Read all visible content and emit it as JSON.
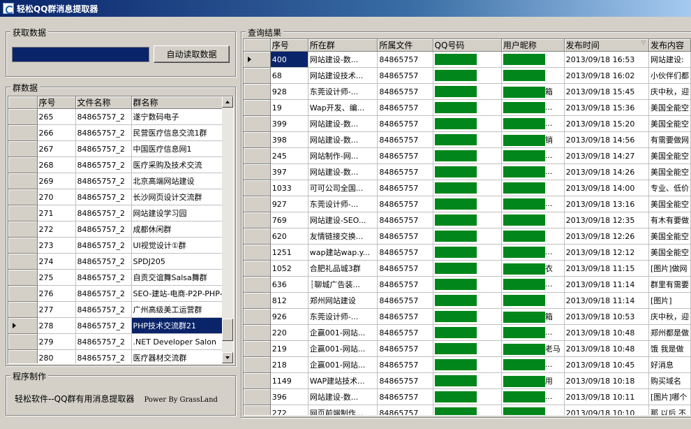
{
  "window": {
    "title": "轻松QQ群消息提取器"
  },
  "fetch_group": {
    "legend": "获取数据",
    "button_label": "自动读取数据"
  },
  "groups_panel": {
    "legend": "群数据",
    "columns": [
      "序号",
      "文件名称",
      "群名称"
    ],
    "rows": [
      {
        "id": "265",
        "file": "84865757_2",
        "name": "遂宁数码电子"
      },
      {
        "id": "266",
        "file": "84865757_2",
        "name": "民营医疗信息交流1群"
      },
      {
        "id": "267",
        "file": "84865757_2",
        "name": "中国医疗信息网1"
      },
      {
        "id": "268",
        "file": "84865757_2",
        "name": "医疗采购及技术交流"
      },
      {
        "id": "269",
        "file": "84865757_2",
        "name": "北京高端网站建设"
      },
      {
        "id": "270",
        "file": "84865757_2",
        "name": "长沙网页设计交流群"
      },
      {
        "id": "271",
        "file": "84865757_2",
        "name": "网站建设学习园"
      },
      {
        "id": "272",
        "file": "84865757_2",
        "name": "成都休闲群"
      },
      {
        "id": "273",
        "file": "84865757_2",
        "name": "UI视觉设计①群"
      },
      {
        "id": "274",
        "file": "84865757_2",
        "name": "SPDJ205"
      },
      {
        "id": "275",
        "file": "84865757_2",
        "name": "自贡交谊舞Salsa舞群"
      },
      {
        "id": "276",
        "file": "84865757_2",
        "name": "SEO-建站-电商-P2P-PHP-"
      },
      {
        "id": "277",
        "file": "84865757_2",
        "name": "广州高级美工运营群"
      },
      {
        "id": "278",
        "file": "84865757_2",
        "name": "PHP技术交流群21",
        "selected": true
      },
      {
        "id": "279",
        "file": "84865757_2",
        "name": ".NET Developer Salon"
      },
      {
        "id": "280",
        "file": "84865757_2",
        "name": "医疗器材交流群"
      }
    ]
  },
  "credits_group": {
    "legend": "程序制作",
    "text": "轻松软件--QQ群有用消息提取器",
    "power": "Power By GrassLand"
  },
  "results_panel": {
    "legend": "查询结果",
    "columns": [
      "序号",
      "所在群",
      "所属文件",
      "QQ号码",
      "用户昵称",
      "发布时间",
      "发布内容"
    ],
    "rows": [
      {
        "id": "400",
        "group": "网站建设-数...",
        "file": "84865757",
        "nick_suffix": "",
        "time": "2013/09/18 16:53",
        "content": "网站建设:",
        "selected": true
      },
      {
        "id": "68",
        "group": "网站建设技术...",
        "file": "84865757",
        "nick_suffix": "",
        "time": "2013/09/18 16:02",
        "content": "小伙伴们都"
      },
      {
        "id": "928",
        "group": "东莞设计师-...",
        "file": "84865757",
        "nick_suffix": "箱",
        "time": "2013/09/18 15:45",
        "content": "庆中秋，迎"
      },
      {
        "id": "19",
        "group": "Wap开发、编...",
        "file": "84865757",
        "nick_suffix": "...",
        "time": "2013/09/18 15:36",
        "content": "美国全能空"
      },
      {
        "id": "399",
        "group": "网站建设-数...",
        "file": "84865757",
        "nick_suffix": "...",
        "time": "2013/09/18 15:20",
        "content": "美国全能空"
      },
      {
        "id": "398",
        "group": "网站建设-数...",
        "file": "84865757",
        "nick_suffix": "销",
        "time": "2013/09/18 14:56",
        "content": "有需要做网"
      },
      {
        "id": "245",
        "group": "网站制作-网...",
        "file": "84865757",
        "nick_suffix": "...",
        "time": "2013/09/18 14:27",
        "content": "美国全能空"
      },
      {
        "id": "397",
        "group": "网站建设-数...",
        "file": "84865757",
        "nick_suffix": "...",
        "time": "2013/09/18 14:26",
        "content": "美国全能空"
      },
      {
        "id": "1033",
        "group": "可可公司全国...",
        "file": "84865757",
        "nick_suffix": "",
        "time": "2013/09/18 14:00",
        "content": "专业、低价"
      },
      {
        "id": "927",
        "group": "东莞设计师-...",
        "file": "84865757",
        "nick_suffix": "...",
        "time": "2013/09/18 13:16",
        "content": "美国全能空"
      },
      {
        "id": "769",
        "group": "网站建设-SEO...",
        "file": "84865757",
        "nick_suffix": "",
        "time": "2013/09/18 12:35",
        "content": "有木有要做"
      },
      {
        "id": "620",
        "group": "友情链接交换...",
        "file": "84865757",
        "nick_suffix": "",
        "time": "2013/09/18 12:26",
        "content": "美国全能空"
      },
      {
        "id": "1251",
        "group": "wap建站wap.y...",
        "file": "84865757",
        "nick_suffix": "...",
        "time": "2013/09/18 12:12",
        "content": "美国全能空"
      },
      {
        "id": "1052",
        "group": "合肥礼品城3群",
        "file": "84865757",
        "nick_suffix": "衣",
        "time": "2013/09/18 11:15",
        "content": "[图片]做网"
      },
      {
        "id": "636",
        "group": "┆聊城广告装...",
        "file": "84865757",
        "nick_suffix": "...",
        "time": "2013/09/18 11:14",
        "content": "群里有需要"
      },
      {
        "id": "812",
        "group": "郑州网站建设",
        "file": "84865757",
        "nick_suffix": "",
        "time": "2013/09/18 11:14",
        "content": "[图片]"
      },
      {
        "id": "926",
        "group": "东莞设计师-...",
        "file": "84865757",
        "nick_suffix": "箱",
        "time": "2013/09/18 10:53",
        "content": "庆中秋，迎"
      },
      {
        "id": "220",
        "group": "企赢001-网站...",
        "file": "84865757",
        "nick_suffix": "...",
        "time": "2013/09/18 10:48",
        "content": "郑州都是做"
      },
      {
        "id": "219",
        "group": "企赢001-网站...",
        "file": "84865757",
        "nick_suffix": "老马",
        "time": "2013/09/18 10:48",
        "content": "饿 我是做"
      },
      {
        "id": "218",
        "group": "企赢001-网站...",
        "file": "84865757",
        "nick_suffix": "...",
        "time": "2013/09/18 10:45",
        "content": "好消息"
      },
      {
        "id": "1149",
        "group": "WAP建站技术...",
        "file": "84865757",
        "nick_suffix": "用",
        "time": "2013/09/18 10:18",
        "content": "购买域名"
      },
      {
        "id": "396",
        "group": "网站建设-数...",
        "file": "84865757",
        "nick_suffix": "...",
        "time": "2013/09/18 10:11",
        "content": "[图片]哪个"
      },
      {
        "id": "272",
        "group": "网页前端制作...",
        "file": "84865757",
        "nick_suffix": "",
        "time": "2013/09/18 10:10",
        "content": "那 以后 不"
      }
    ]
  },
  "colors": {
    "selection": "#0a246a",
    "redaction": "#00861a",
    "face": "#d4d0c8"
  }
}
